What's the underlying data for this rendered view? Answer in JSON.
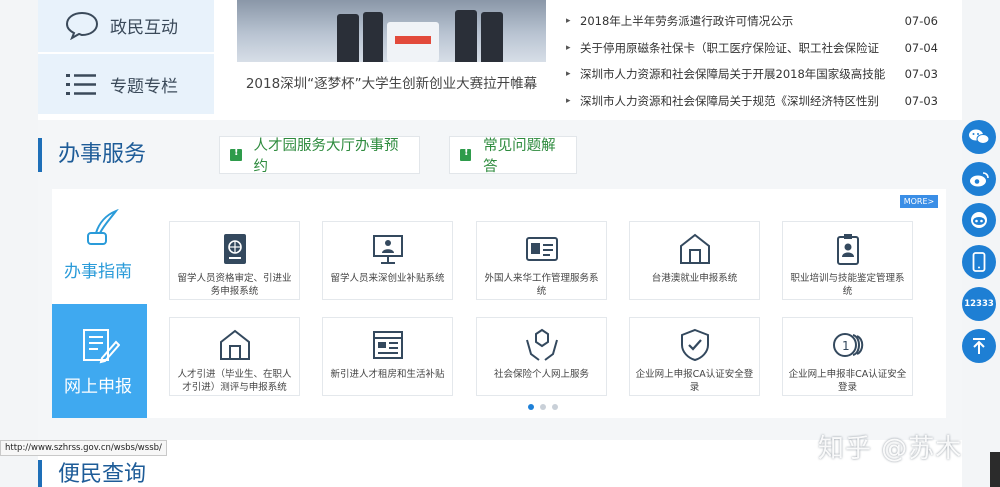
{
  "nav_tiles": [
    {
      "label": "政民互动",
      "icon": "chat-bubble-icon"
    },
    {
      "label": "专题专栏",
      "icon": "list-icon"
    }
  ],
  "banner": {
    "caption": "2018深圳“逐梦杯”大学生创新创业大赛拉开帷幕"
  },
  "news": [
    {
      "title": "2018年上半年劳务派遣行政许可情况公示",
      "date": "07-06"
    },
    {
      "title": "关于停用原磁条社保卡（职工医疗保险证、职工社会保险证",
      "date": "07-04"
    },
    {
      "title": "深圳市人力资源和社会保障局关于开展2018年国家级高技能",
      "date": "07-03"
    },
    {
      "title": "深圳市人力资源和社会保障局关于规范《深圳经济特区性别",
      "date": "07-03"
    }
  ],
  "services": {
    "title": "办事服务",
    "pills": [
      "人才园服务大厅办事预约",
      "常见问题解答"
    ],
    "more": "MORE>",
    "side": {
      "guide": "办事指南",
      "online": "网上申报"
    },
    "cards_row1": [
      {
        "label": "留学人员资格审定、引进业务申报系统",
        "icon": "passport-icon"
      },
      {
        "label": "留学人员来深创业补贴系统",
        "icon": "presentation-icon"
      },
      {
        "label": "外国人来华工作管理服务系统",
        "icon": "id-card-icon"
      },
      {
        "label": "台港澳就业申报系统",
        "icon": "house-icon"
      },
      {
        "label": "职业培训与技能鉴定管理系统",
        "icon": "badge-icon"
      }
    ],
    "cards_row2": [
      {
        "label": "人才引进（毕业生、在职人才引进）测评与申报系统",
        "icon": "house-icon"
      },
      {
        "label": "新引进人才租房和生活补贴",
        "icon": "web-page-icon"
      },
      {
        "label": "社会保险个人网上服务",
        "icon": "hands-box-icon"
      },
      {
        "label": "企业网上申报CA认证安全登录",
        "icon": "shield-check-icon"
      },
      {
        "label": "企业网上申报非CA认证安全登录",
        "icon": "coins-icon"
      }
    ]
  },
  "query": {
    "title": "便民查询"
  },
  "status_url": "http://www.szhrss.gov.cn/wsbs/wssb/",
  "float_bar": {
    "hotline": "12333"
  },
  "watermark": "知乎 @苏木"
}
